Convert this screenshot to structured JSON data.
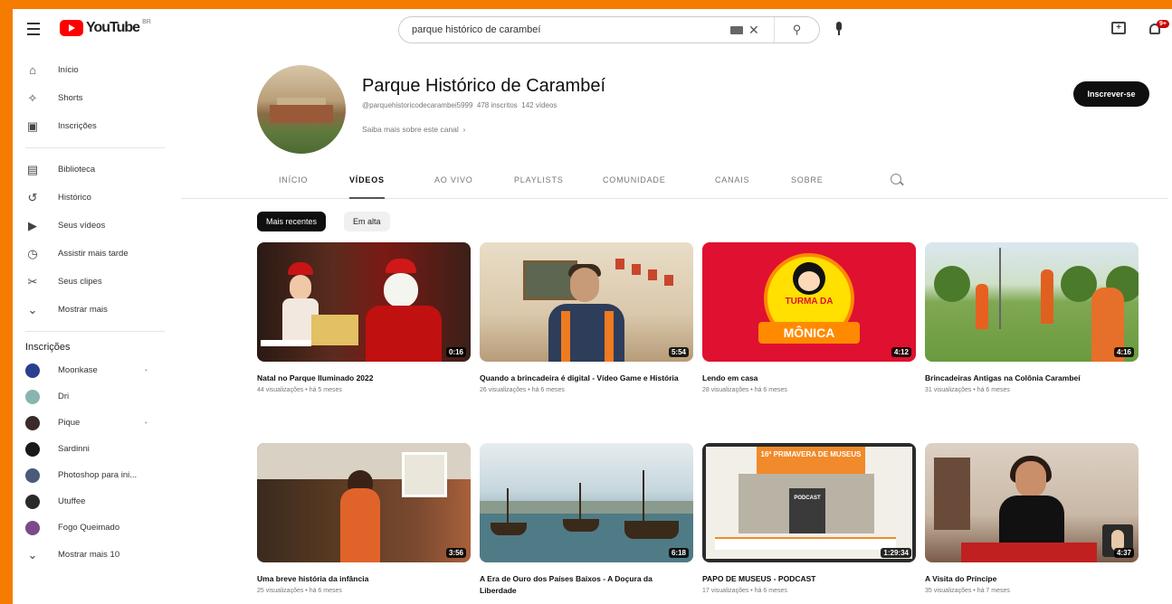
{
  "topbar": {
    "logo_text": "YouTube",
    "logo_sup": "BR",
    "search_value": "parque histórico de carambeí",
    "notification_count": "9+"
  },
  "sidebar": {
    "main": [
      {
        "label": "Início",
        "icon": "home-icon",
        "glyph": "⌂"
      },
      {
        "label": "Shorts",
        "icon": "shorts-icon",
        "glyph": "✧"
      },
      {
        "label": "Inscrições",
        "icon": "subscriptions-icon",
        "glyph": "▣"
      }
    ],
    "library": [
      {
        "label": "Biblioteca",
        "icon": "library-icon",
        "glyph": "▤"
      },
      {
        "label": "Histórico",
        "icon": "history-icon",
        "glyph": "↺"
      },
      {
        "label": "Seus vídeos",
        "icon": "your-videos-icon",
        "glyph": "▶"
      },
      {
        "label": "Assistir mais tarde",
        "icon": "watch-later-icon",
        "glyph": "◷"
      },
      {
        "label": "Seus clipes",
        "icon": "clips-icon",
        "glyph": "✂"
      },
      {
        "label": "Mostrar mais",
        "icon": "chevron-down-icon",
        "glyph": "⌄"
      }
    ],
    "subscriptions_title": "Inscrições",
    "subscriptions": [
      {
        "label": "Moonkase",
        "color": "#2a3f8f",
        "dot": true
      },
      {
        "label": "Dri",
        "color": "#8ab4b0",
        "dot": false
      },
      {
        "label": "Pique",
        "color": "#3a2a2a",
        "dot": true
      },
      {
        "label": "Sardinni",
        "color": "#1a1a1a",
        "dot": false
      },
      {
        "label": "Photoshop para ini...",
        "color": "#4a5a7a",
        "dot": false
      },
      {
        "label": "Utuffee",
        "color": "#2a2a2a",
        "dot": false
      },
      {
        "label": "Fogo Queimado",
        "color": "#7a4a8a",
        "dot": false
      }
    ],
    "show_more_subs": "Mostrar mais 10"
  },
  "channel": {
    "name": "Parque Histórico de Carambeí",
    "handle": "@parquehistoricodecarambei5999",
    "subscribers": "478 inscritos",
    "videos_count": "142 vídeos",
    "about_link": "Saiba mais sobre este canal",
    "subscribe_label": "Inscrever-se"
  },
  "tabs": [
    "INÍCIO",
    "VÍDEOS",
    "AO VIVO",
    "PLAYLISTS",
    "COMUNIDADE",
    "CANAIS",
    "SOBRE"
  ],
  "active_tab": "VÍDEOS",
  "chips": {
    "recent": "Mais recentes",
    "popular": "Em alta"
  },
  "videos": [
    {
      "title": "Natal no Parque Iluminado 2022",
      "meta": "44 visualizações • há 5 meses",
      "duration": "0:16"
    },
    {
      "title": "Quando a brincadeira é digital - Vídeo Game e História",
      "meta": "26 visualizações • há 6 meses",
      "duration": "5:54"
    },
    {
      "title": "Lendo em casa",
      "meta": "28 visualizações • há 6 meses",
      "duration": "4:12"
    },
    {
      "title": "Brincadeiras Antigas na Colônia Carambeí",
      "meta": "31 visualizações • há 6 meses",
      "duration": "4:16"
    },
    {
      "title": "Uma breve história da infância",
      "meta": "25 visualizações • há 6 meses",
      "duration": "3:56"
    },
    {
      "title": "A Era de Ouro dos Países Baixos - A Doçura da Liberdade",
      "meta": "",
      "duration": "6:18"
    },
    {
      "title": "PAPO DE MUSEUS - PODCAST",
      "meta": "17 visualizações • há 6 meses",
      "duration": "1:29:34"
    },
    {
      "title": "A Visita do Príncipe",
      "meta": "35 visualizações • há 7 meses",
      "duration": "4:37"
    }
  ],
  "thumb_text": {
    "v3_line1": "TURMA DA",
    "v3_line2": "MÔNICA",
    "v7_line1": "16ª PRIMAVERA DE MUSEUS",
    "v7_line2": "PODCAST"
  }
}
